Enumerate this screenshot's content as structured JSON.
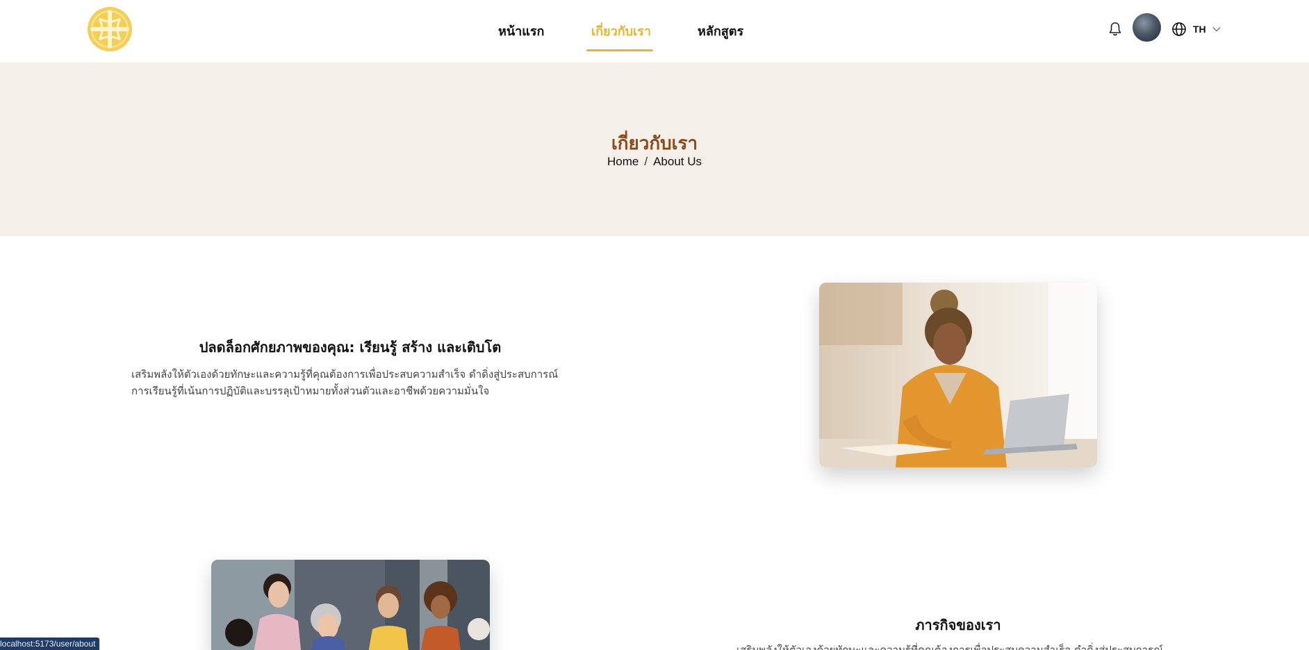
{
  "header": {
    "logo_name": "brand-logo",
    "nav": [
      {
        "label": "หน้าแรก",
        "active": false
      },
      {
        "label": "เกี่ยวกับเรา",
        "active": true
      },
      {
        "label": "หลักสูตร",
        "active": false
      }
    ],
    "language": "TH",
    "accent_color": "#e9b52e"
  },
  "hero": {
    "title": "เกี่ยวกับเรา",
    "breadcrumb": {
      "home": "Home",
      "separator": "/",
      "current": "About Us"
    },
    "background": "#f4efe8",
    "title_color": "#8a4b1c"
  },
  "section1": {
    "heading": "ปลดล็อกศักยภาพของคุณ: เรียนรู้ สร้าง และเติบโต",
    "body_line1": "เสริมพลังให้ตัวเองด้วยทักษะและความรู้ที่คุณต้องการเพื่อประสบความสำเร็จ ดำดิ่งสู่ประสบการณ์",
    "body_line2": "การเรียนรู้ที่เน้นการปฏิบัติและบรรลุเป้าหมายทั้งส่วนตัวและอาชีพด้วยความมั่นใจ",
    "image_name": "student-studying-photo"
  },
  "section2": {
    "heading": "ภารกิจของเรา",
    "body_line1": "เสริมพลังให้ตัวเองด้วยทักษะและความรู้ที่คุณต้องการเพื่อประสบความสำเร็จ ดำดิ่งสู่ประสบการณ์",
    "image_name": "team-group-photo"
  },
  "status_bar": {
    "url": "localhost:5173/user/about"
  }
}
